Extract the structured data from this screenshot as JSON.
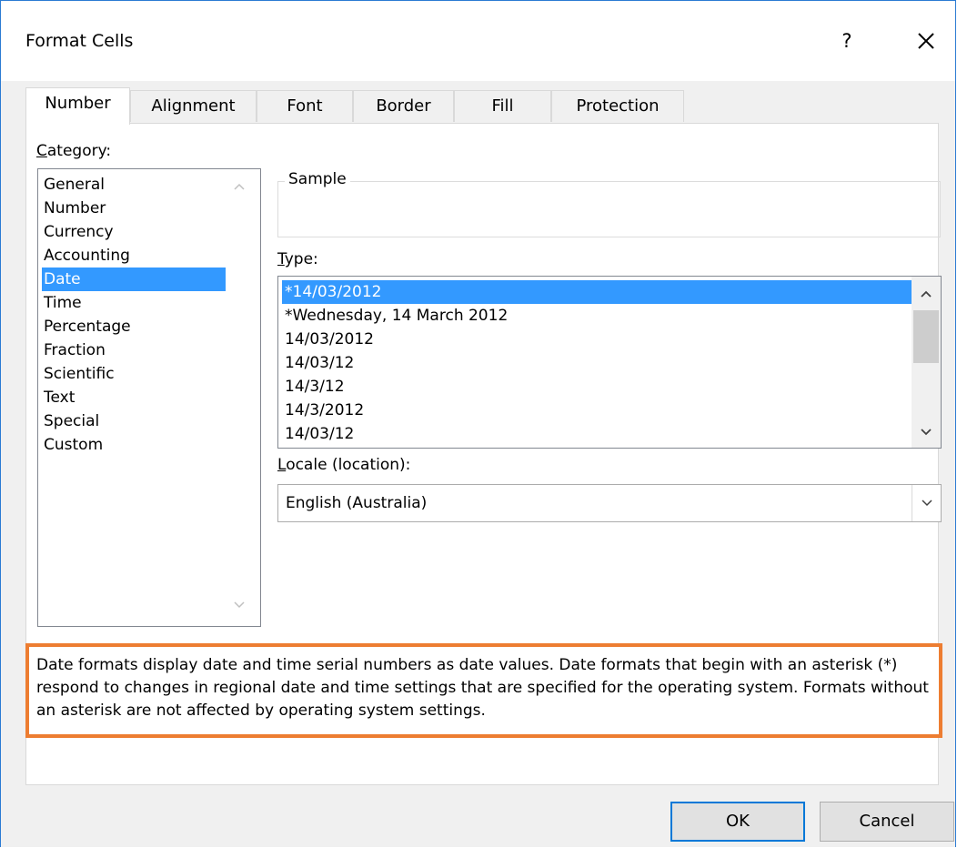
{
  "window": {
    "title": "Format Cells",
    "help_label": "?",
    "close_icon": "close-icon"
  },
  "tabs": [
    {
      "label": "Number",
      "active": true
    },
    {
      "label": "Alignment",
      "active": false
    },
    {
      "label": "Font",
      "active": false
    },
    {
      "label": "Border",
      "active": false
    },
    {
      "label": "Fill",
      "active": false
    },
    {
      "label": "Protection",
      "active": false
    }
  ],
  "category": {
    "label": "Category:",
    "items": [
      "General",
      "Number",
      "Currency",
      "Accounting",
      "Date",
      "Time",
      "Percentage",
      "Fraction",
      "Scientific",
      "Text",
      "Special",
      "Custom"
    ],
    "selected": "Date"
  },
  "sample": {
    "label": "Sample",
    "value": ""
  },
  "type": {
    "label": "Type:",
    "items": [
      "*14/03/2012",
      "*Wednesday, 14 March 2012",
      "14/03/2012",
      "14/03/12",
      "14/3/12",
      "14/3/2012",
      "14/03/12"
    ],
    "selected": "*14/03/2012"
  },
  "locale": {
    "label": "Locale (location):",
    "value": "English (Australia)"
  },
  "description": "Date formats display date and time serial numbers as date values.  Date formats that begin with an asterisk (*) respond to changes in regional date and time settings that are specified for the operating system. Formats without an asterisk are not affected by operating system settings.",
  "buttons": {
    "ok": "OK",
    "cancel": "Cancel"
  },
  "colors": {
    "selection": "#3399ff",
    "highlight_border": "#ed7d31",
    "default_button_border": "#0078d7",
    "window_border": "#2b7bd3"
  }
}
